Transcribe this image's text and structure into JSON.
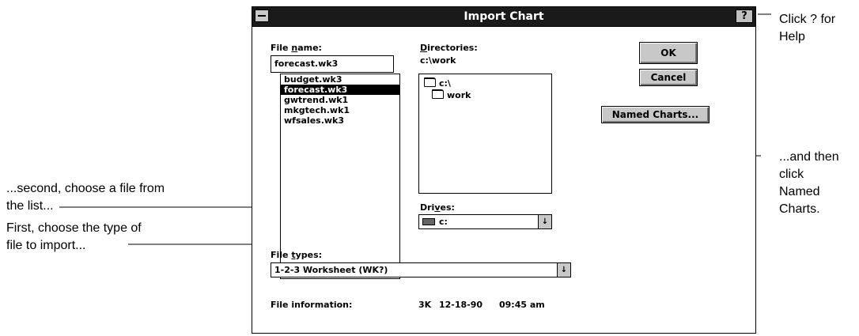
{
  "dialog": {
    "title": "Import Chart",
    "help_button": "?",
    "file_name": {
      "label_pre": "File ",
      "label_u": "n",
      "label_post": "ame:",
      "value": "forecast.wk3",
      "files": [
        "budget.wk3",
        "forecast.wk3",
        "gwtrend.wk1",
        "mkgtech.wk1",
        "wfsales.wk3"
      ],
      "selected_index": 1
    },
    "directories": {
      "label_u": "D",
      "label_post": "irectories:",
      "current": "c:\\work",
      "items": [
        "c:\\",
        "work"
      ]
    },
    "drives": {
      "label_pre": "Dri",
      "label_u": "v",
      "label_post": "es:",
      "value": "c:"
    },
    "file_types": {
      "label_pre": "File ",
      "label_u": "t",
      "label_post": "ypes:",
      "value": "1-2-3 Worksheet (WK?)"
    },
    "file_info": {
      "label": "File information:",
      "size": "3K",
      "date": "12-18-90",
      "time": "09:45 am"
    },
    "buttons": {
      "ok": "OK",
      "cancel": "Cancel",
      "named_charts": "Named Charts..."
    }
  },
  "callouts": {
    "help_1": "Click ? for",
    "help_2": "Help",
    "named_1": "...and then",
    "named_2": "click",
    "named_3": "Named",
    "named_4": "Charts.",
    "second_1": "...second, choose a file from",
    "second_2": "the list...",
    "first_1": "First, choose the type of",
    "first_2": "file to import..."
  },
  "icons": {
    "sysmenu": "system-menu-icon",
    "arrow": "↓",
    "drive": "hard-drive-icon",
    "folder": "folder-icon"
  }
}
